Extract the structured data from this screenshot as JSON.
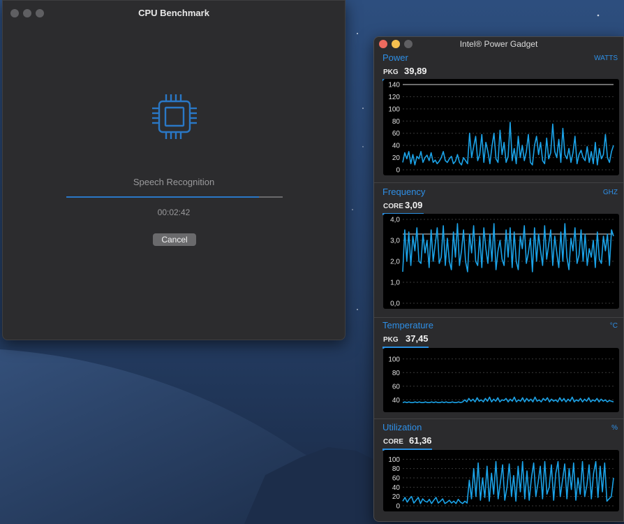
{
  "colors": {
    "accent": "#2e8fe6",
    "graph_line": "#1ba3e8",
    "graph_bg": "#000000",
    "window_bg": "#2c2c2e",
    "close": "#ed6a5e",
    "minimize": "#f5bf4f",
    "zoom_inactive": "#5f5f62"
  },
  "benchmark": {
    "title": "CPU Benchmark",
    "icon": "cpu-chip-icon",
    "task": "Speech Recognition",
    "progress": 0.89,
    "elapsed": "00:02:42",
    "cancel_label": "Cancel"
  },
  "gadget": {
    "title": "Intel® Power Gadget",
    "panels": [
      {
        "id": "power",
        "title": "Power",
        "unit": "WATTS",
        "metric_label": "PKG",
        "metric_value": "39,89",
        "chart_data": {
          "type": "line",
          "ylim": [
            0,
            140
          ],
          "yticks": [
            "140",
            "120",
            "100",
            "80",
            "60",
            "40",
            "20",
            "0"
          ],
          "ytick_values": [
            140,
            120,
            100,
            80,
            60,
            40,
            20,
            0
          ],
          "reference_line": 140,
          "series": [
            {
              "values": [
                12,
                28,
                18,
                30,
                10,
                25,
                8,
                22,
                18,
                30,
                12,
                20,
                24,
                15,
                28,
                12,
                16,
                10,
                14,
                20,
                30,
                15,
                12,
                18,
                22,
                10,
                14,
                25,
                12,
                8,
                20,
                15,
                10,
                60,
                20,
                38,
                55,
                15,
                25,
                58,
                12,
                45,
                30,
                10,
                38,
                60,
                18,
                12,
                65,
                25,
                45,
                12,
                22,
                78,
                15,
                35,
                10,
                55,
                20,
                40,
                15,
                30,
                58,
                12,
                8,
                40,
                55,
                25,
                45,
                15,
                10,
                52,
                18,
                28,
                75,
                30,
                20,
                50,
                12,
                68,
                25,
                18,
                35,
                12,
                28,
                55,
                10,
                25,
                32,
                20,
                15,
                38,
                12,
                30,
                10,
                45,
                8,
                35,
                18,
                25,
                58,
                20,
                12,
                30,
                40
              ]
            }
          ]
        }
      },
      {
        "id": "frequency",
        "title": "Frequency",
        "unit": "GHZ",
        "metric_label": "CORE",
        "metric_value": "3,09",
        "chart_data": {
          "type": "line",
          "ylim": [
            0,
            4.0
          ],
          "yticks": [
            "4,0",
            "3,0",
            "2,0",
            "1,0",
            "0,0"
          ],
          "ytick_values": [
            4,
            3,
            2,
            1,
            0
          ],
          "reference_line": 3.3,
          "series": [
            {
              "values": [
                1.5,
                3.5,
                2.0,
                3.4,
                1.8,
                3.2,
                2.5,
                3.6,
                2.0,
                1.9,
                3.3,
                2.4,
                3.0,
                1.7,
                3.5,
                2.0,
                2.8,
                3.6,
                1.9,
                2.2,
                3.7,
                1.8,
                3.1,
                2.0,
                1.6,
                3.4,
                2.2,
                3.8,
                1.8,
                2.5,
                3.5,
                2.0,
                1.5,
                3.3,
                2.4,
                3.7,
                2.0,
                1.8,
                3.2,
                1.7,
                3.6,
                2.6,
                1.9,
                3.3,
                2.0,
                3.8,
                1.6,
                2.5,
                3.0,
                2.1,
                1.8,
                3.5,
                2.2,
                3.6,
                1.7,
                3.4,
                2.0,
                1.6,
                3.2,
                2.6,
                3.7,
                1.9,
                2.4,
                3.1,
                1.5,
                3.6,
                2.0,
                3.3,
                2.5,
                1.8,
                3.7,
                2.1,
                2.8,
                3.5,
                1.8,
                3.2,
                2.4,
                1.7,
                3.4,
                2.0,
                3.8,
                2.2,
                1.6,
                3.1,
                2.5,
                3.6,
                1.9,
                2.3,
                3.5,
                2.0,
                3.3,
                1.8,
                2.6,
                2.2,
                3.0,
                1.7,
                3.4,
                2.1,
                1.9,
                3.2,
                2.5,
                3.3,
                1.8,
                3.5,
                3.2
              ]
            }
          ]
        }
      },
      {
        "id": "temperature",
        "title": "Temperature",
        "unit": "°C",
        "metric_label": "PKG",
        "metric_value": "37,45",
        "chart_data": {
          "type": "line",
          "ylim": [
            30,
            108
          ],
          "yticks": [
            "100",
            "80",
            "60",
            "40"
          ],
          "ytick_values": [
            100,
            80,
            60,
            40
          ],
          "series": [
            {
              "values": [
                36,
                37,
                36,
                37,
                36,
                36,
                37,
                36,
                37,
                36,
                36,
                37,
                36,
                36,
                37,
                36,
                37,
                36,
                36,
                37,
                36,
                37,
                36,
                36,
                37,
                36,
                36,
                37,
                36,
                37,
                40,
                37,
                42,
                38,
                41,
                37,
                43,
                38,
                40,
                37,
                42,
                38,
                44,
                37,
                41,
                38,
                43,
                37,
                40,
                39,
                42,
                37,
                41,
                38,
                44,
                37,
                40,
                38,
                43,
                37,
                42,
                38,
                41,
                37,
                44,
                38,
                40,
                37,
                42,
                39,
                43,
                37,
                41,
                38,
                40,
                37,
                43,
                38,
                42,
                37,
                41,
                38,
                44,
                37,
                40,
                38,
                42,
                37,
                41,
                38,
                43,
                37,
                40,
                38,
                42,
                37,
                41,
                38,
                40,
                37,
                39,
                38,
                37
              ]
            }
          ]
        }
      },
      {
        "id": "utilization",
        "title": "Utilization",
        "unit": "%",
        "metric_label": "CORE",
        "metric_value": "61,36",
        "chart_data": {
          "type": "line",
          "ylim": [
            0,
            108
          ],
          "yticks": [
            "100",
            "80",
            "60",
            "40",
            "20",
            "0"
          ],
          "ytick_values": [
            100,
            80,
            60,
            40,
            20,
            0
          ],
          "series": [
            {
              "values": [
                10,
                18,
                8,
                15,
                20,
                6,
                12,
                18,
                5,
                15,
                10,
                8,
                14,
                5,
                12,
                18,
                6,
                10,
                15,
                5,
                8,
                12,
                6,
                10,
                5,
                14,
                8,
                5,
                10,
                6,
                55,
                15,
                80,
                20,
                92,
                12,
                60,
                18,
                85,
                10,
                70,
                25,
                95,
                15,
                50,
                88,
                12,
                40,
                90,
                20,
                65,
                10,
                85,
                30,
                95,
                15,
                75,
                12,
                60,
                92,
                20,
                50,
                85,
                15,
                95,
                25,
                40,
                88,
                12,
                70,
                95,
                20,
                55,
                90,
                15,
                80,
                35,
                92,
                12,
                60,
                25,
                95,
                20,
                45,
                88,
                15,
                70,
                95,
                18,
                85,
                30,
                92,
                10,
                15,
                20,
                60
              ]
            }
          ]
        }
      }
    ]
  }
}
